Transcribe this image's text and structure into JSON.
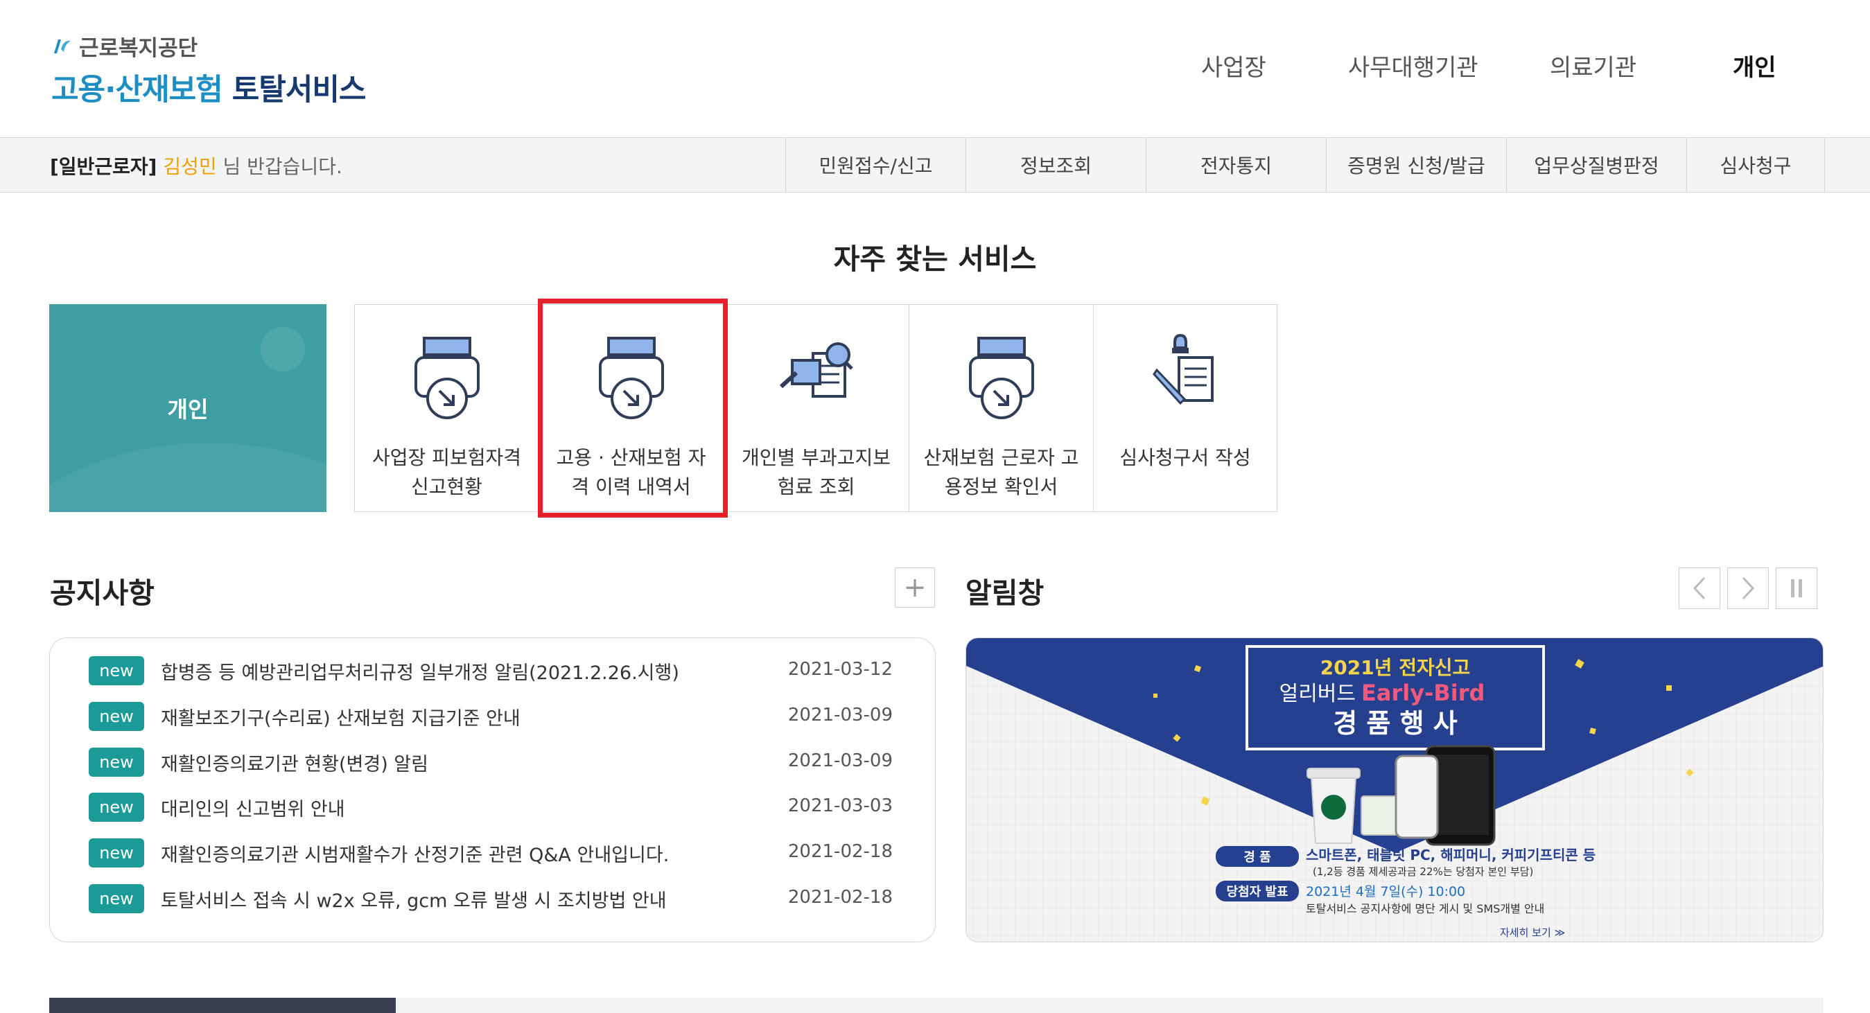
{
  "brand": {
    "org": "근로복지공단",
    "title_a": "고용·산재보험",
    "title_b": "토탈서비스"
  },
  "top_nav": [
    {
      "label": "사업장",
      "active": false
    },
    {
      "label": "사무대행기관",
      "active": false
    },
    {
      "label": "의료기관",
      "active": false
    },
    {
      "label": "개인",
      "active": true
    }
  ],
  "greeting": {
    "role": "[일반근로자]",
    "name": "김성민",
    "suffix": "님 반갑습니다."
  },
  "sub_nav": [
    "민원접수/신고",
    "정보조회",
    "전자통지",
    "증명원 신청/발급",
    "업무상질병판정",
    "심사청구"
  ],
  "frequent": {
    "title": "자주 찾는 서비스",
    "category_label": "개인",
    "services": [
      {
        "label": "사업장 피보험자격 신고현황",
        "icon": "printer-download-icon"
      },
      {
        "label": "고용 · 산재보험 자격 이력 내역서",
        "icon": "printer-download-icon",
        "highlighted": true
      },
      {
        "label": "개인별 부과고지보험료 조회",
        "icon": "document-search-icon"
      },
      {
        "label": "산재보험 근로자 고용정보 확인서",
        "icon": "printer-download-icon"
      },
      {
        "label": "심사청구서 작성",
        "icon": "document-pen-icon"
      }
    ]
  },
  "notice": {
    "title": "공지사항",
    "more": "+",
    "items": [
      {
        "badge": "new",
        "text": "합병증 등 예방관리업무처리규정 일부개정 알림(2021.2.26.시행)",
        "date": "2021-03-12"
      },
      {
        "badge": "new",
        "text": "재활보조기구(수리료) 산재보험 지급기준 안내",
        "date": "2021-03-09"
      },
      {
        "badge": "new",
        "text": "재활인증의료기관 현황(변경) 알림",
        "date": "2021-03-09"
      },
      {
        "badge": "new",
        "text": "대리인의 신고범위 안내",
        "date": "2021-03-03"
      },
      {
        "badge": "new",
        "text": "재활인증의료기관 시범재활수가 산정기준 관련 Q&A 안내입니다.",
        "date": "2021-02-18"
      },
      {
        "badge": "new",
        "text": "토탈서비스 접속 시 w2x 오류, gcm 오류 발생 시 조치방법 안내",
        "date": "2021-02-18"
      }
    ]
  },
  "alert": {
    "title": "알림창",
    "banner": {
      "headline1": "2021년 전자신고",
      "headline2a": "얼리버드",
      "headline2b": "Early-Bird",
      "headline3": "경 품 행 사",
      "prize_label": "경   품",
      "prize_text": "스마트폰, 태블릿 PC, 해피머니, 커피기프티콘 등",
      "prize_note": "(1,2등 경품 제세공과금 22%는 당첨자 본인 부담)",
      "winner_label": "당첨자 발표",
      "winner_date": "2021년 4월 7일(수) 10:00",
      "winner_note": "토탈서비스 공지사항에 명단 게시 및 SMS개별 안내",
      "more": "자세히 보기 ≫"
    }
  },
  "colors": {
    "teal": "#1a9b98",
    "highlight": "#e8202a",
    "banner_blue": "#24408e",
    "accent_yellow": "#f0a000"
  }
}
